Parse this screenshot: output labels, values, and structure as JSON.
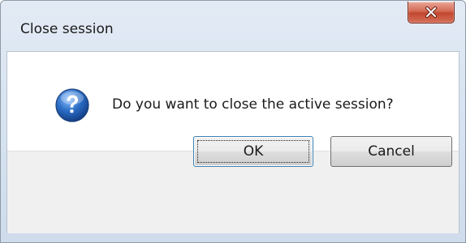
{
  "window": {
    "title": "Close session",
    "close_icon": "close-x-icon"
  },
  "message": {
    "icon": "question-icon",
    "text": "Do you want to close the active session?"
  },
  "buttons": {
    "ok_label": "OK",
    "cancel_label": "Cancel"
  },
  "colors": {
    "close_button": "#c9533b",
    "icon_blue": "#2a6cc4",
    "button_area": "#f0f0f0"
  }
}
